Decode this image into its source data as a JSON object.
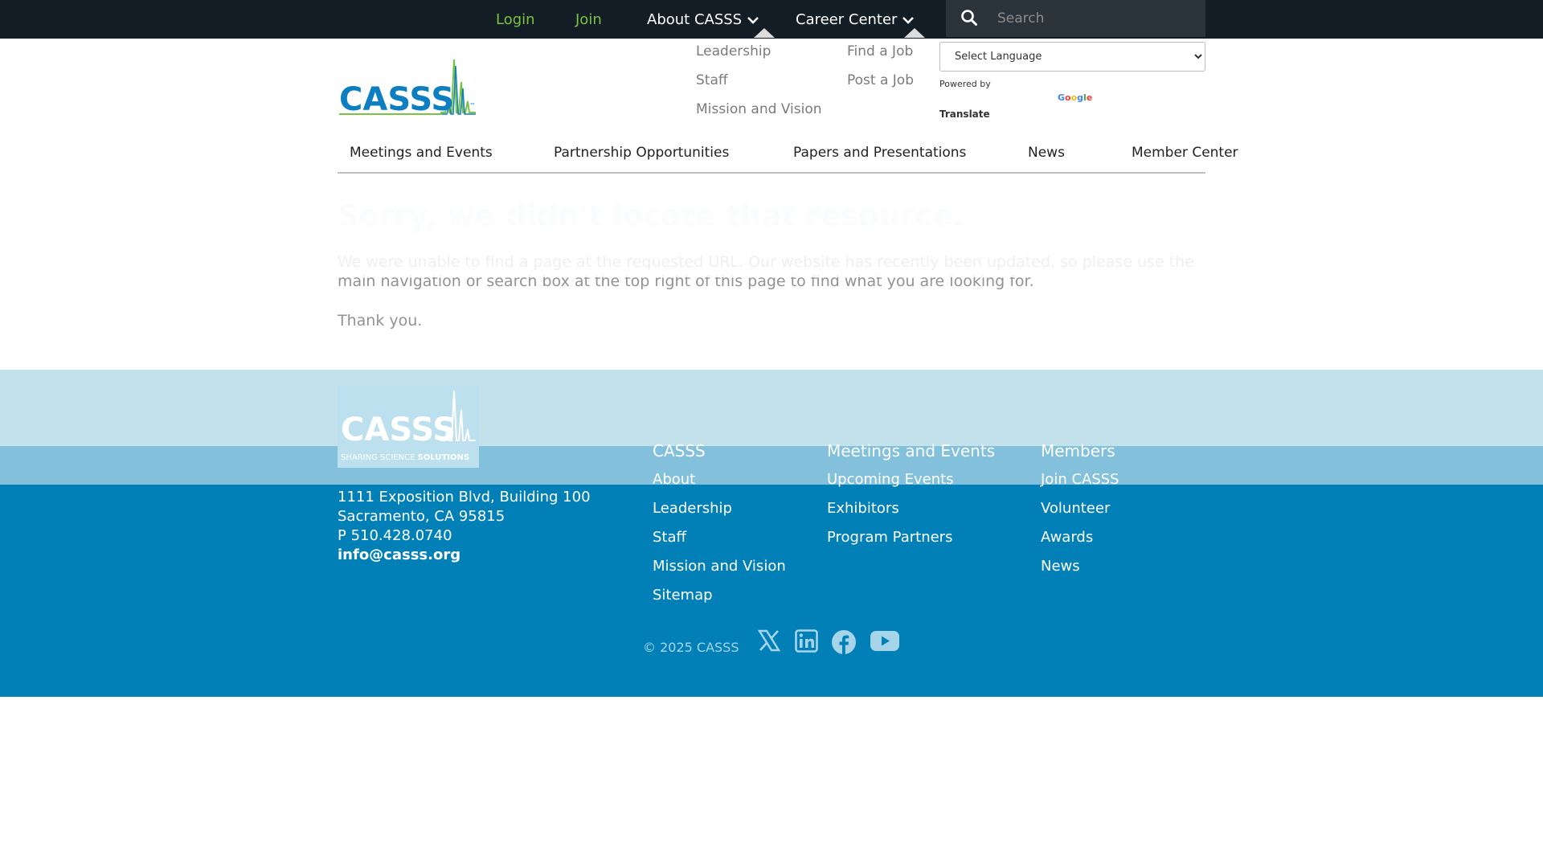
{
  "colors": {
    "topbar": "#131d25",
    "accent_green": "#7bc142",
    "footer_blue": "#0180b8",
    "light_band": "#c3e2ec",
    "mid_band": "#82c0db"
  },
  "topbar": {
    "login": "Login",
    "join": "Join",
    "about": "About CASSS",
    "career": "Career Center",
    "search_placeholder": "Search",
    "about_menu": [
      "Leadership",
      "Staff",
      "Mission and Vision"
    ],
    "career_menu": [
      "Find a Job",
      "Post a Job"
    ]
  },
  "translate": {
    "select_label": "Select Language",
    "powered_by": "Powered by",
    "google": "Google",
    "translate": "Translate"
  },
  "logo": {
    "text": "CASSS",
    "tm": "™"
  },
  "mainnav": [
    "Meetings and Events",
    "Partnership Opportunities",
    "Papers and Presentations",
    "News",
    "Member Center"
  ],
  "content": {
    "title": "Sorry, we didn't locate that resource.",
    "body": "We were unable to find a page at the requested URL. Our website has recently been updated, so please use the main navigation or search box at the top right of this page to find what you are looking for.",
    "thanks": "Thank you."
  },
  "footer": {
    "logo_text": "CASSS",
    "tagline_a": "SHARING SCIENCE ",
    "tagline_b": "SOLUTIONS",
    "address1": "1111 Exposition Blvd, Building 100",
    "address2": "Sacramento, CA 95815",
    "phone": "P 510.428.0740",
    "email": "info@casss.org",
    "col1": {
      "heading": "CASSS",
      "links": [
        "About",
        "Leadership",
        "Staff",
        "Mission and Vision",
        "Sitemap"
      ]
    },
    "col2": {
      "heading": "Meetings and Events",
      "links": [
        "Upcoming Events",
        "Exhibitors",
        "Program Partners"
      ]
    },
    "col3": {
      "heading": "Members",
      "links": [
        "Join CASSS",
        "Volunteer",
        "Awards",
        "News"
      ]
    },
    "copyright": "© 2025 CASSS",
    "social": [
      "x-icon",
      "linkedin-icon",
      "facebook-icon",
      "youtube-icon"
    ]
  }
}
